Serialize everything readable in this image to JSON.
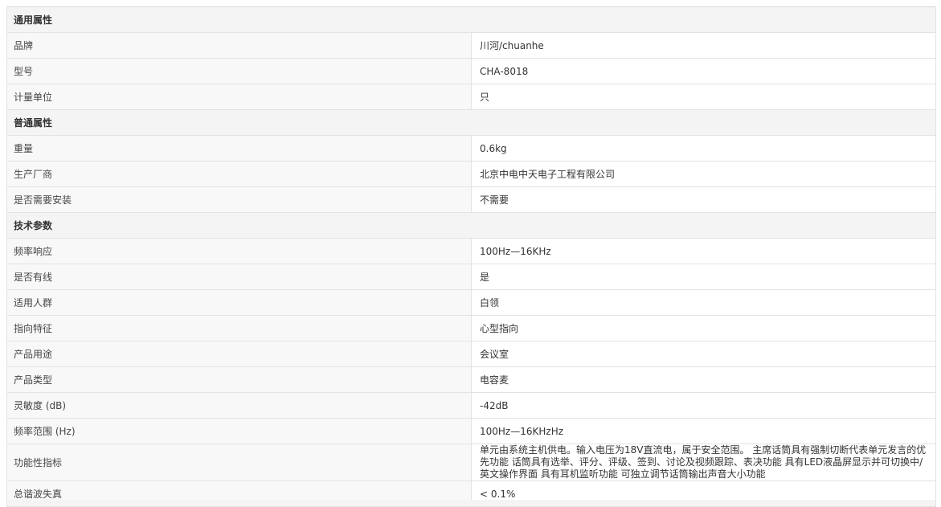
{
  "sections": [
    {
      "title": "通用属性",
      "rows": [
        {
          "label": "品牌",
          "value": "川河/chuanhe"
        },
        {
          "label": "型号",
          "value": "CHA-8018"
        },
        {
          "label": "计量单位",
          "value": "只"
        }
      ]
    },
    {
      "title": "普通属性",
      "rows": [
        {
          "label": "重量",
          "value": "0.6kg"
        },
        {
          "label": "生产厂商",
          "value": "北京中电中天电子工程有限公司"
        },
        {
          "label": "是否需要安装",
          "value": "不需要"
        }
      ]
    },
    {
      "title": "技术参数",
      "rows": [
        {
          "label": "频率响应",
          "value": "100Hz—16KHz"
        },
        {
          "label": "是否有线",
          "value": "是"
        },
        {
          "label": "适用人群",
          "value": "白领"
        },
        {
          "label": "指向特征",
          "value": "心型指向"
        },
        {
          "label": "产品用途",
          "value": "会议室"
        },
        {
          "label": "产品类型",
          "value": "电容麦"
        },
        {
          "label": "灵敏度 (dB)",
          "value": "-42dB"
        },
        {
          "label": "频率范围 (Hz)",
          "value": "100Hz—16KHzHz"
        },
        {
          "label": "功能性指标",
          "value": "单元由系统主机供电。输入电压为18V直流电，属于安全范围。 主席话筒具有强制切断代表单元发言的优先功能 话筒具有选举、评分、评级、签到、讨论及视频跟踪、表决功能 具有LED液晶屏显示并可切换中/英文操作界面 具有耳机监听功能 可独立调节话筒输出声音大小功能"
        },
        {
          "label": "总谐波失真",
          "value": "< 0.1%"
        }
      ]
    }
  ]
}
